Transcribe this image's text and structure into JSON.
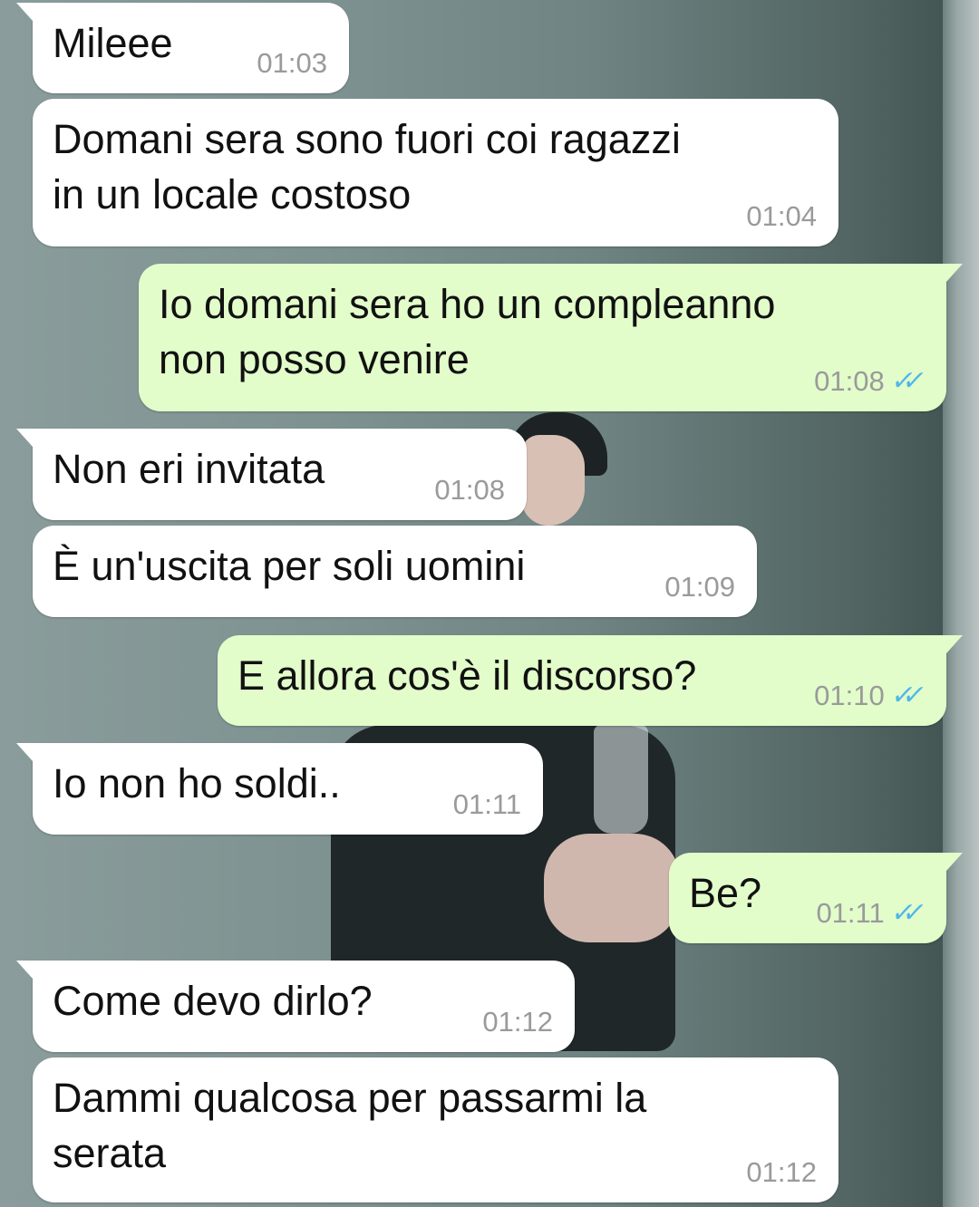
{
  "accent": {
    "incoming_bubble": "#ffffff",
    "outgoing_bubble": "#e2fdca",
    "read_check": "#4fb6ec"
  },
  "messages": [
    {
      "direction": "in",
      "text": "Mileee",
      "time": "01:03"
    },
    {
      "direction": "in",
      "text": "Domani sera sono fuori coi ragazzi\nin un locale costoso",
      "time": "01:04"
    },
    {
      "direction": "out",
      "text": "Io domani sera ho un compleanno\nnon posso venire",
      "time": "01:08",
      "status_icon": "double-check-read"
    },
    {
      "direction": "in",
      "text": "Non eri invitata",
      "time": "01:08"
    },
    {
      "direction": "in",
      "text": "È un'uscita per soli uomini",
      "time": "01:09"
    },
    {
      "direction": "out",
      "text": "E allora cos'è il discorso?",
      "time": "01:10",
      "status_icon": "double-check-read"
    },
    {
      "direction": "in",
      "text": "Io non ho soldi..",
      "time": "01:11"
    },
    {
      "direction": "out",
      "text": "Be?",
      "time": "01:11",
      "status_icon": "double-check-read"
    },
    {
      "direction": "in",
      "text": "Come devo dirlo?",
      "time": "01:12"
    },
    {
      "direction": "in",
      "text": "Dammi qualcosa per passarmi la\nserata",
      "time": "01:12"
    }
  ]
}
